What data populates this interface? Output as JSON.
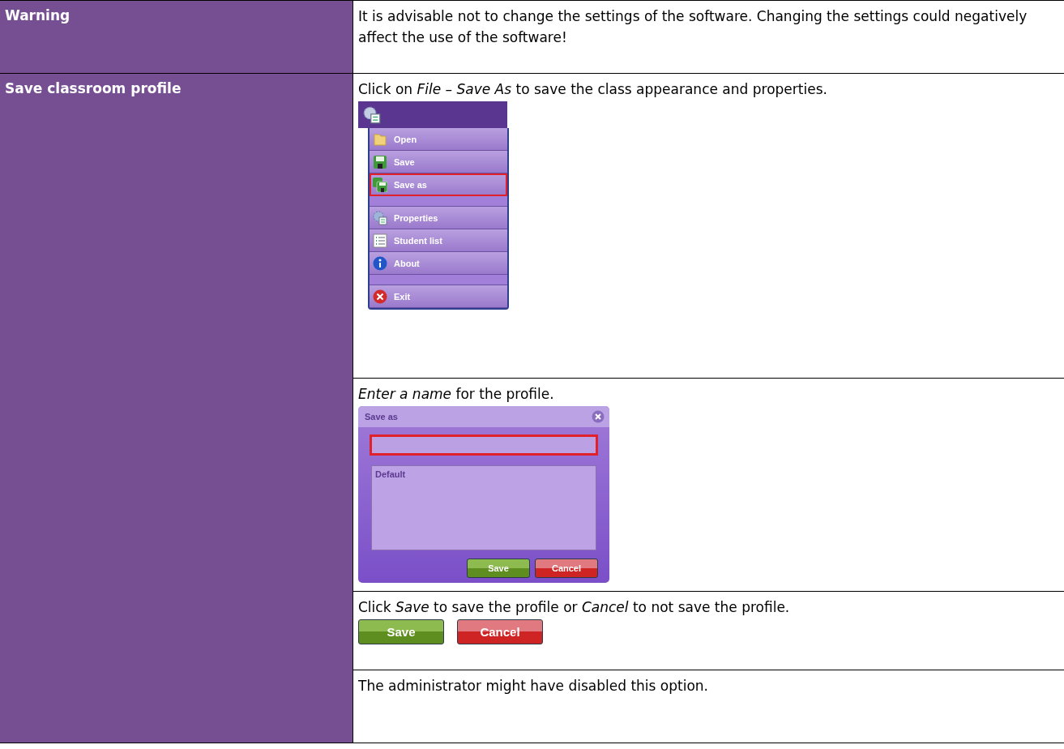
{
  "rows": [
    {
      "heading": "Warning",
      "steps": [
        {
          "kind": "text",
          "text": "It is advisable not to change the settings of the software. Changing the settings could negatively affect the use of the software!"
        }
      ]
    },
    {
      "heading": "Save classroom profile",
      "steps": [
        {
          "kind": "menu",
          "text": "Click on *File – Save As* to save the class appearance and properties.",
          "items": [
            {
              "kind": "open",
              "label": "Open",
              "selected": false
            },
            {
              "kind": "save",
              "label": "Save",
              "selected": false
            },
            {
              "kind": "saveas",
              "label": "Save as",
              "selected": true
            },
            {
              "kind": "gap"
            },
            {
              "kind": "properties",
              "label": "Properties",
              "selected": false
            },
            {
              "kind": "list",
              "label": "Student list",
              "selected": false
            },
            {
              "kind": "about",
              "label": "About",
              "selected": false
            },
            {
              "kind": "gap"
            },
            {
              "kind": "exit",
              "label": "Exit",
              "selected": false
            }
          ]
        },
        {
          "kind": "dialog",
          "text": "*Enter a name* for the profile.",
          "title": "Save as",
          "field_selected": true,
          "list_items": [
            "Default"
          ],
          "buttons": [
            {
              "kind": "ok",
              "label": "Save"
            },
            {
              "kind": "cancel",
              "label": "Cancel"
            }
          ]
        },
        {
          "kind": "buttons",
          "text": "Click *Save* to save the profile or *Cancel* to not save the profile.",
          "buttons": [
            {
              "kind": "ok",
              "label": "Save"
            },
            {
              "kind": "cancel",
              "label": "Cancel"
            }
          ]
        },
        {
          "kind": "text",
          "text": "The administrator might have disabled this option."
        }
      ]
    }
  ]
}
